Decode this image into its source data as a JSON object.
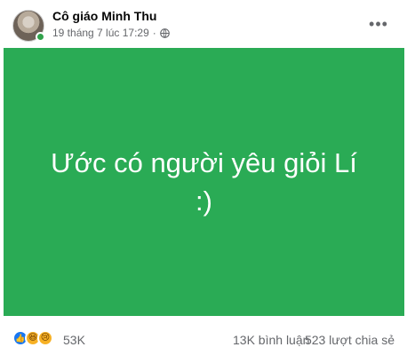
{
  "header": {
    "author": "Cô giáo Minh Thu",
    "timestamp": "19 tháng 7 lúc 17:29",
    "separator": "·",
    "privacy_icon": "globe-icon",
    "more_label": "•••"
  },
  "post": {
    "text": "Ước có người yêu giỏi Lí :)",
    "background_color": "#2aab55"
  },
  "stats": {
    "reactions_icons": [
      "like-icon",
      "haha-icon",
      "sad-icon"
    ],
    "reactions_count": "53K",
    "comments": "13K bình luận",
    "shares": "523 lượt chia sẻ"
  }
}
